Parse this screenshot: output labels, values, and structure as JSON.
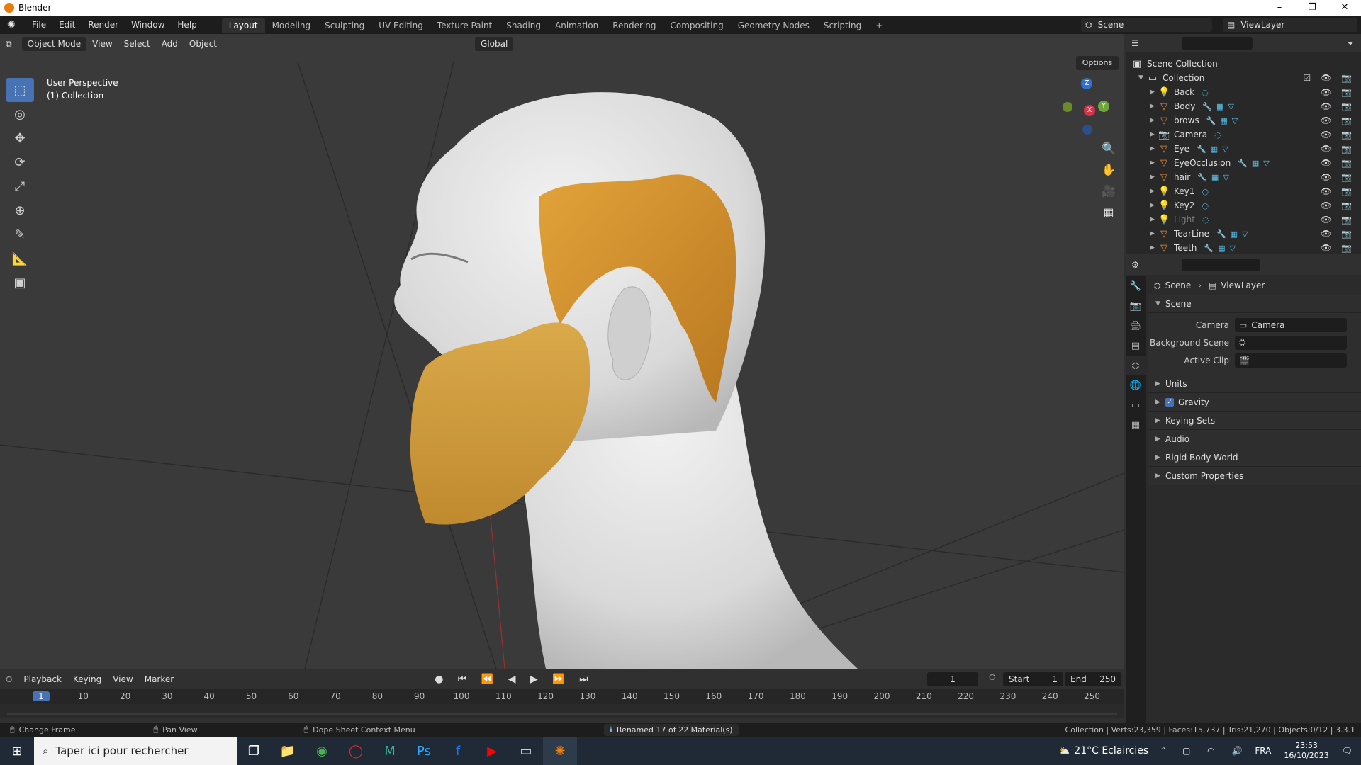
{
  "window": {
    "title": "Blender",
    "controls": [
      "–",
      "❐",
      "✕"
    ]
  },
  "menus": [
    "File",
    "Edit",
    "Render",
    "Window",
    "Help"
  ],
  "workspaces": [
    "Layout",
    "Modeling",
    "Sculpting",
    "UV Editing",
    "Texture Paint",
    "Shading",
    "Animation",
    "Rendering",
    "Compositing",
    "Geometry Nodes",
    "Scripting"
  ],
  "active_workspace": "Layout",
  "add_workspace": "+",
  "scene": {
    "name": "Scene"
  },
  "view_layer": {
    "name": "ViewLayer"
  },
  "viewport": {
    "mode": "Object Mode",
    "menus": [
      "View",
      "Select",
      "Add",
      "Object"
    ],
    "transform_orientation": "Global",
    "options": "Options",
    "perspective": "User Perspective",
    "collection": "(1) Collection",
    "gizmo": {
      "x": "X",
      "y": "Y",
      "z": "Z"
    }
  },
  "outliner": {
    "root": "Scene Collection",
    "collection": "Collection",
    "items": [
      {
        "name": "Back",
        "type": "light"
      },
      {
        "name": "Body",
        "type": "mesh"
      },
      {
        "name": "brows",
        "type": "mesh"
      },
      {
        "name": "Camera",
        "type": "camera"
      },
      {
        "name": "Eye",
        "type": "mesh"
      },
      {
        "name": "EyeOcclusion",
        "type": "mesh"
      },
      {
        "name": "hair",
        "type": "mesh"
      },
      {
        "name": "Key1",
        "type": "light"
      },
      {
        "name": "Key2",
        "type": "light"
      },
      {
        "name": "Light",
        "type": "light",
        "disabled": true
      },
      {
        "name": "TearLine",
        "type": "mesh"
      },
      {
        "name": "Teeth",
        "type": "mesh"
      }
    ]
  },
  "properties": {
    "breadcrumb": [
      "Scene",
      "ViewLayer"
    ],
    "scene_panel": "Scene",
    "camera_label": "Camera",
    "camera_value": "Camera",
    "background_scene_label": "Background Scene",
    "active_clip_label": "Active Clip",
    "panels": [
      "Units",
      "Gravity",
      "Keying Sets",
      "Audio",
      "Rigid Body World",
      "Custom Properties"
    ],
    "gravity_checked": true
  },
  "timeline": {
    "menus": [
      "Playback",
      "Keying",
      "View",
      "Marker"
    ],
    "current_frame": "1",
    "start_label": "Start",
    "start": "1",
    "end_label": "End",
    "end": "250",
    "ticks": [
      "1",
      "10",
      "20",
      "30",
      "40",
      "50",
      "60",
      "70",
      "80",
      "90",
      "100",
      "110",
      "120",
      "130",
      "140",
      "150",
      "160",
      "170",
      "180",
      "190",
      "200",
      "210",
      "220",
      "230",
      "240",
      "250"
    ]
  },
  "status": {
    "left": "Change Frame",
    "middle": "Pan View",
    "right": "Dope Sheet Context Menu",
    "message": "Renamed 17 of 22 Material(s)",
    "stats": "Collection | Verts:23,359 | Faces:15,737 | Tris:21,270 | Objects:0/12 | 3.3.1"
  },
  "taskbar": {
    "search_placeholder": "Taper ici pour rechercher",
    "weather": "21°C  Eclaircies",
    "lang": "FRA",
    "time": "23:53",
    "date": "16/10/2023"
  },
  "colors": {
    "accent": "#4772b3",
    "blender_orange": "#e87d0d",
    "hair": "#c58a2a"
  }
}
